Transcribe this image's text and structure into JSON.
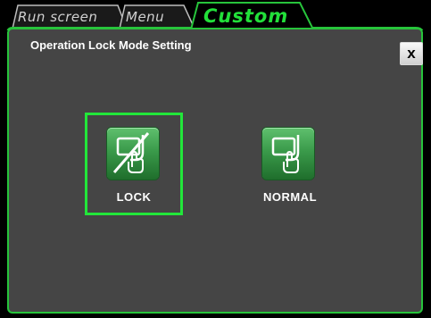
{
  "tabs": [
    {
      "label": "Run screen",
      "active": false
    },
    {
      "label": "Menu",
      "active": false
    },
    {
      "label": "Custom",
      "active": true
    }
  ],
  "dialog": {
    "title": "Operation Lock Mode Setting",
    "close_label": "x"
  },
  "options": {
    "lock": {
      "label": "LOCK",
      "selected": true,
      "icon": "hand-on-screen-slashed-icon"
    },
    "normal": {
      "label": "NORMAL",
      "selected": false,
      "icon": "hand-on-screen-icon"
    }
  },
  "colors": {
    "accent": "#22e63a",
    "panel": "#454545",
    "background": "#000000"
  }
}
